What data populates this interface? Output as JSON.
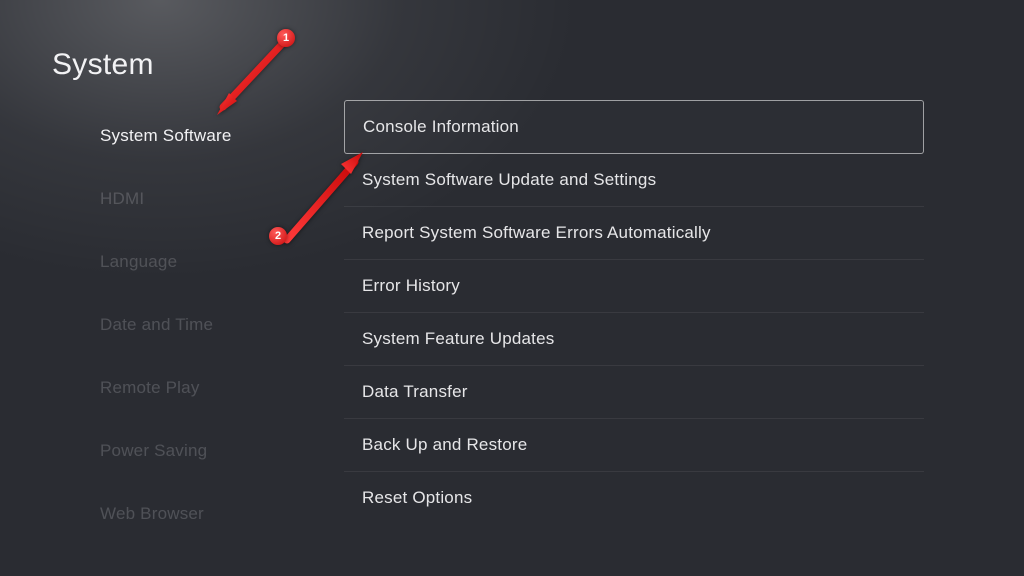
{
  "title": "System",
  "sidebar": {
    "items": [
      {
        "label": "System Software",
        "active": true
      },
      {
        "label": "HDMI",
        "active": false
      },
      {
        "label": "Language",
        "active": false
      },
      {
        "label": "Date and Time",
        "active": false
      },
      {
        "label": "Remote Play",
        "active": false
      },
      {
        "label": "Power Saving",
        "active": false
      },
      {
        "label": "Web Browser",
        "active": false
      }
    ]
  },
  "main": {
    "items": [
      {
        "label": "Console Information",
        "selected": true
      },
      {
        "label": "System Software Update and Settings",
        "selected": false
      },
      {
        "label": "Report System Software Errors Automatically",
        "selected": false
      },
      {
        "label": "Error History",
        "selected": false
      },
      {
        "label": "System Feature Updates",
        "selected": false
      },
      {
        "label": "Data Transfer",
        "selected": false
      },
      {
        "label": "Back Up and Restore",
        "selected": false
      },
      {
        "label": "Reset Options",
        "selected": false
      }
    ]
  },
  "annotations": {
    "badge1": "1",
    "badge2": "2",
    "color": "#e01010"
  }
}
